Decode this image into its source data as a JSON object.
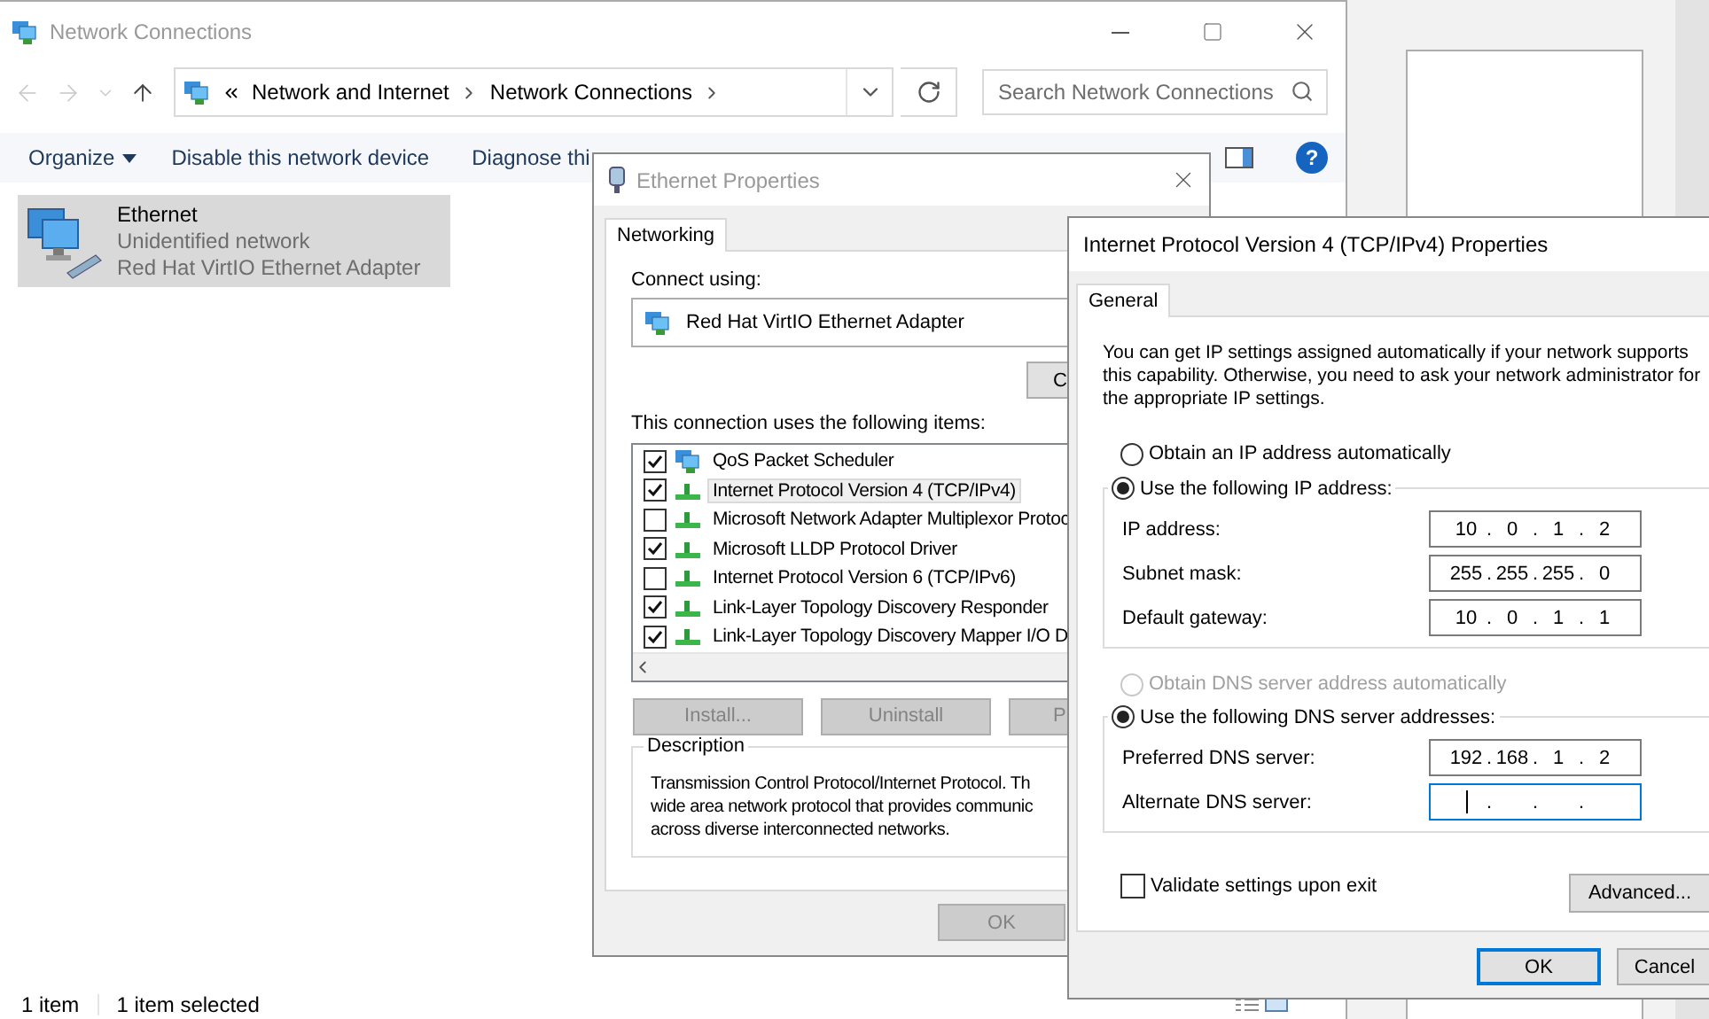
{
  "explorer": {
    "title": "Network Connections",
    "breadcrumb": [
      "Network and Internet",
      "Network Connections"
    ],
    "search": {
      "placeholder": "Search Network Connections"
    },
    "toolbar": [
      {
        "label": "Organize",
        "kind": "menu"
      },
      {
        "label": "Disable this network device",
        "kind": "command"
      },
      {
        "label": "Diagnose thi",
        "kind": "command"
      }
    ],
    "items": [
      {
        "name": "Ethernet",
        "status": "Unidentified network",
        "adapter": "Red Hat VirtIO Ethernet Adapter",
        "selected": true
      }
    ],
    "help_button": "?",
    "status_bar": [
      "1 item",
      "1 item selected"
    ]
  },
  "ethernet_properties": {
    "title": "Ethernet Properties",
    "tabs": [
      {
        "label": "Networking",
        "selected": true
      }
    ],
    "connect_using_label": "Connect using:",
    "adapter": "Red Hat VirtIO Ethernet Adapter",
    "configure_button": "C",
    "items_label": "This connection uses the following items:",
    "items": [
      {
        "label": "QoS Packet Scheduler",
        "checked": true,
        "selected": false,
        "kind": "service"
      },
      {
        "label": "Internet Protocol Version 4 (TCP/IPv4)",
        "checked": true,
        "selected": true,
        "kind": "protocol"
      },
      {
        "label": "Microsoft Network Adapter Multiplexor Protoc",
        "checked": false,
        "selected": false,
        "kind": "protocol"
      },
      {
        "label": "Microsoft LLDP Protocol Driver",
        "checked": true,
        "selected": false,
        "kind": "protocol"
      },
      {
        "label": "Internet Protocol Version 6 (TCP/IPv6)",
        "checked": false,
        "selected": false,
        "kind": "protocol"
      },
      {
        "label": "Link-Layer Topology Discovery Responder",
        "checked": true,
        "selected": false,
        "kind": "protocol"
      },
      {
        "label": "Link-Layer Topology Discovery Mapper I/O D",
        "checked": true,
        "selected": false,
        "kind": "protocol"
      }
    ],
    "buttons": [
      {
        "label": "Install...",
        "disabled": true
      },
      {
        "label": "Uninstall",
        "disabled": true
      },
      {
        "label": "P",
        "disabled": true
      }
    ],
    "description": {
      "title": "Description",
      "text": "Transmission Control Protocol/Internet Protocol. Th\nwide area network protocol that provides communic\nacross diverse interconnected networks."
    },
    "ok_button": {
      "label": "OK",
      "disabled": true
    }
  },
  "ipv4_properties": {
    "title": "Internet Protocol Version 4 (TCP/IPv4) Properties",
    "tabs": [
      {
        "label": "General",
        "selected": true
      }
    ],
    "intro": "You can get IP settings assigned automatically if your network supports this capability. Otherwise, you need to ask your network administrator for the appropriate IP settings.",
    "separator": ".",
    "ip_modes": [
      {
        "label": "Obtain an IP address automatically",
        "selected": false,
        "disabled": false
      },
      {
        "label": "Use the following IP address:",
        "selected": true,
        "disabled": false
      }
    ],
    "ip_fields": [
      {
        "label": "IP address:",
        "octets": [
          "10",
          "0",
          "1",
          "2"
        ],
        "focused": false
      },
      {
        "label": "Subnet mask:",
        "octets": [
          "255",
          "255",
          "255",
          "0"
        ],
        "focused": false
      },
      {
        "label": "Default gateway:",
        "octets": [
          "10",
          "0",
          "1",
          "1"
        ],
        "focused": false
      }
    ],
    "dns_modes": [
      {
        "label": "Obtain DNS server address automatically",
        "selected": false,
        "disabled": true
      },
      {
        "label": "Use the following DNS server addresses:",
        "selected": true,
        "disabled": false
      }
    ],
    "dns_fields": [
      {
        "label": "Preferred DNS server:",
        "octets": [
          "192",
          "168",
          "1",
          "2"
        ],
        "focused": false
      },
      {
        "label": "Alternate DNS server:",
        "focused": true
      }
    ],
    "validate": {
      "label": "Validate settings upon exit",
      "checked": false
    },
    "advanced_button": "Advanced...",
    "buttons": [
      {
        "label": "OK",
        "default": true
      },
      {
        "label": "Cancel",
        "default": false
      }
    ]
  }
}
